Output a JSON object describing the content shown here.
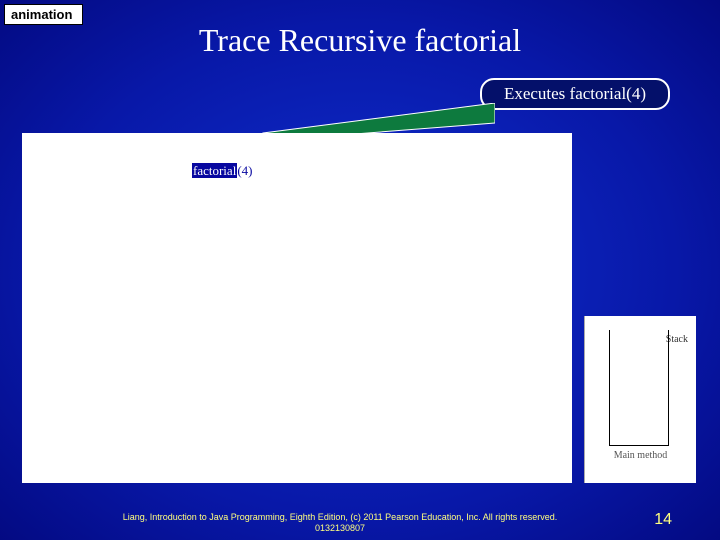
{
  "tag": "animation",
  "title": "Trace Recursive factorial",
  "callout": "Executes factorial(4)",
  "diagram": {
    "call_name": "factorial",
    "call_arg": "(4)"
  },
  "stack": {
    "top_label": "Stack",
    "bottom_label": "Main method"
  },
  "footer": "Liang, Introduction to Java Programming, Eighth Edition, (c) 2011 Pearson Education, Inc. All rights reserved. 0132130807",
  "page_number": "14"
}
